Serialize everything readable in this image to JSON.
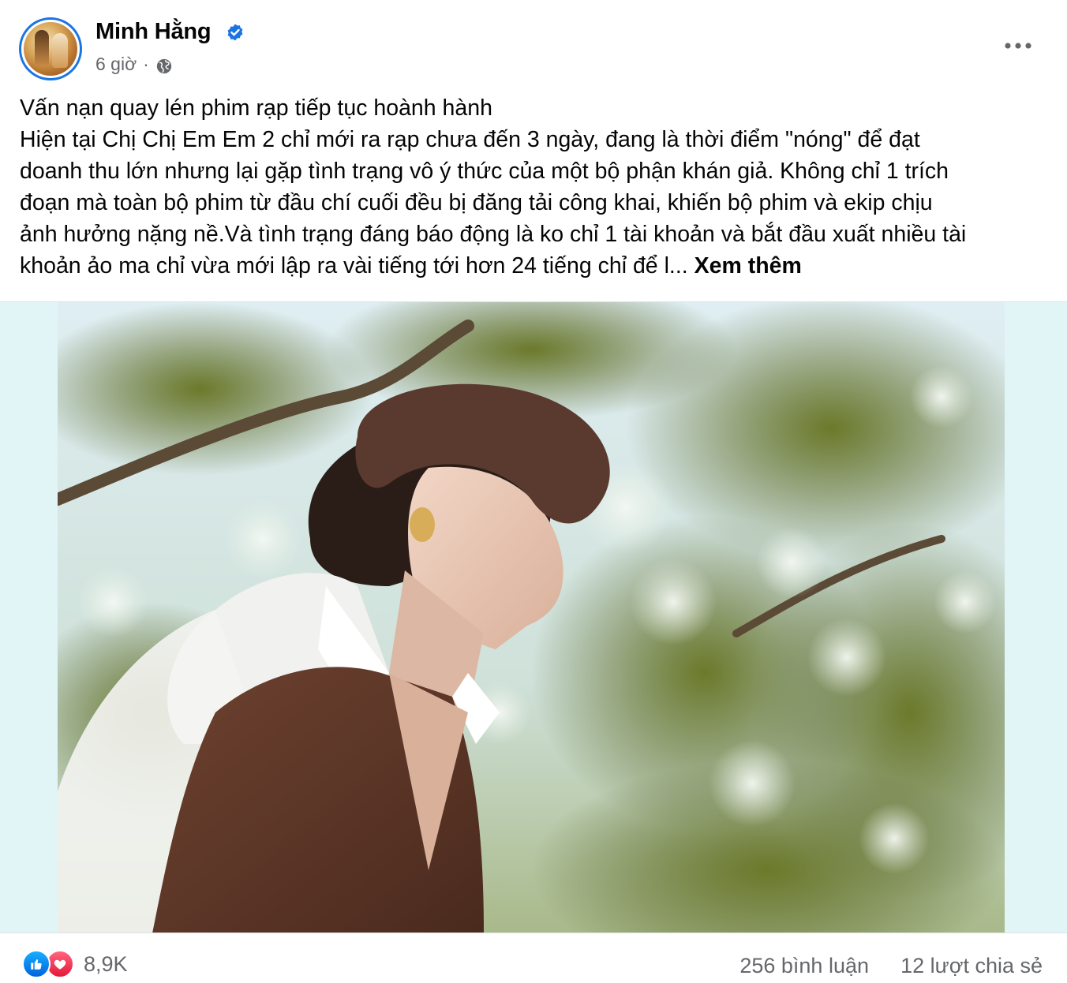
{
  "post": {
    "author": "Minh Hằng",
    "time": "6 giờ",
    "separator": "·",
    "text_lines": [
      "Vấn nạn quay lén phim rạp tiếp tục hoành hành",
      "Hiện tại Chị Chị Em Em 2 chỉ mới ra rạp chưa đến 3 ngày, đang là thời điểm \"nóng\" để đạt",
      "doanh thu lớn nhưng lại gặp tình trạng vô ý thức của một bộ phận khán giả. Không chỉ 1 trích",
      "đoạn mà toàn bộ phim từ đầu chí cuối đều bị đăng tải công khai, khiến bộ phim và ekip chịu",
      "ảnh hưởng nặng nề.Và tình trạng đáng báo động là ko chỉ 1 tài khoản và bắt đầu xuất nhiều tài",
      "khoản ảo ma chỉ vừa mới lập ra vài tiếng tới hơn 24 tiếng chỉ để l... "
    ],
    "see_more": "Xem thêm"
  },
  "footer": {
    "reaction_count": "8,9K",
    "comments": "256 bình luận",
    "shares": "12 lượt chia sẻ"
  },
  "icons": {
    "verified": "verified-badge-icon",
    "privacy": "globe-icon",
    "more": "more-options-icon",
    "reactions": [
      "like-icon",
      "love-icon"
    ]
  },
  "colors": {
    "verified_blue": "#1b74e4",
    "secondary_text": "#65676b",
    "like_blue": "#0866ff",
    "love_red": "#f33e58",
    "photo_backdrop": "#e1f4f6"
  }
}
